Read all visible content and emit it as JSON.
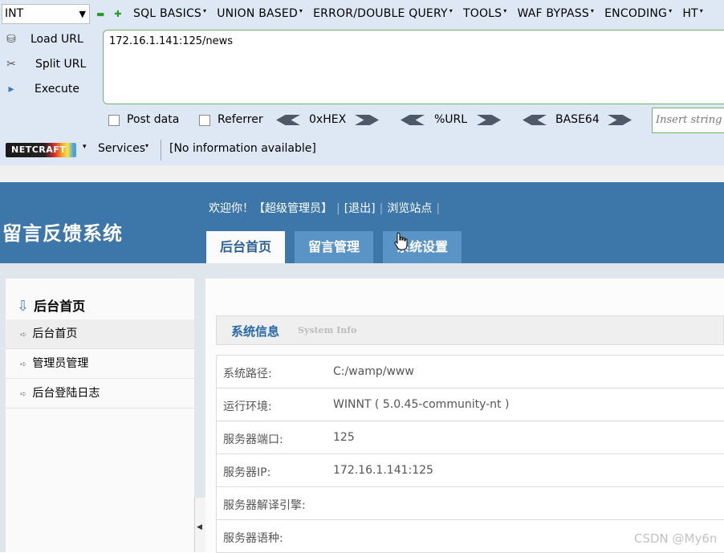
{
  "hackbar": {
    "type_select": "INT",
    "menus": [
      "SQL BASICS",
      "UNION BASED",
      "ERROR/DOUBLE QUERY",
      "TOOLS",
      "WAF BYPASS",
      "ENCODING",
      "HT"
    ],
    "load_url": "Load URL",
    "split_url": "Split URL",
    "execute": "Execute",
    "url_value": "172.16.1.141:125/news",
    "post_data": "Post data",
    "referrer": "Referrer",
    "hex": "0xHEX",
    "url_enc": "%URL",
    "base64": "BASE64",
    "insert_placeholder": "Insert string"
  },
  "netcraft": {
    "logo": "NETCRAFT",
    "services": "Services",
    "info": "[No information available]"
  },
  "header": {
    "system_title": "留言反馈系统",
    "welcome": "欢迎你！【超级管理员】",
    "logout": "[退出]",
    "browse_site": "浏览站点",
    "tabs": [
      "后台首页",
      "留言管理",
      "系统设置"
    ]
  },
  "sidebar": {
    "heading": "后台首页",
    "items": [
      "后台首页",
      "管理员管理",
      "后台登陆日志"
    ]
  },
  "info": {
    "title": "系统信息",
    "subtitle": "System Info",
    "rows": [
      {
        "label": "系统路径:",
        "value": "C:/wamp/www"
      },
      {
        "label": "运行环境:",
        "value": "WINNT ( 5.0.45-community-nt )"
      },
      {
        "label": "服务器端口:",
        "value": "125"
      },
      {
        "label": "服务器IP:",
        "value": "172.16.1.141:125"
      },
      {
        "label": "服务器解译引擎:",
        "value": ""
      },
      {
        "label": "服务器语种:",
        "value": ""
      }
    ]
  },
  "watermark": "CSDN @My6n"
}
